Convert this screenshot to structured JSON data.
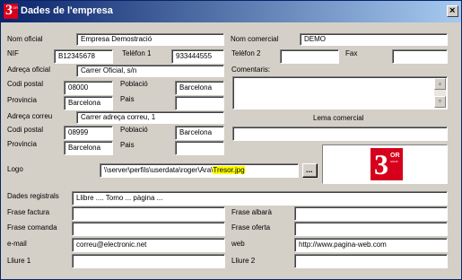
{
  "window": {
    "title": "Dades de l'empresa",
    "app_icon_text": "3",
    "app_icon_sup": "OR"
  },
  "labels": {
    "nom_oficial": "Nom oficial",
    "nif": "NIF",
    "telefon1": "Telèfon 1",
    "nom_comercial": "Nom comercial",
    "telefon2": "Telèfon 2",
    "fax": "Fax",
    "adreca_oficial": "Adreça oficial",
    "comentaris": "Comentaris:",
    "codi_postal": "Codi postal",
    "poblacio": "Població",
    "provincia": "Provincia",
    "pais": "Pais",
    "adreca_correu": "Adreça correu",
    "lema_comercial": "Lema comercial",
    "codi_postal2": "Codi postal",
    "poblacio2": "Població",
    "provincia2": "Provincia",
    "pais2": "Pais",
    "logo": "Logo",
    "dades_registrals": "Dades registrals",
    "frase_factura": "Frase factura",
    "frase_albara": "Frase albarà",
    "frase_comanda": "Frase comanda",
    "frase_oferta": "Frase oferta",
    "email": "e-mail",
    "web": "web",
    "lliure1": "Lliure 1",
    "lliure2": "Lliure 2"
  },
  "values": {
    "nom_oficial": "Empresa Demostració",
    "nif": "B12345678",
    "telefon1": "933444555",
    "nom_comercial": "DEMO",
    "telefon2": "",
    "fax": "",
    "adreca_oficial": "Carrer Oficial, s/n",
    "codi_postal": "08000",
    "poblacio": "Barcelona",
    "provincia": "Barcelona",
    "pais": "",
    "adreca_correu": "Carrer adreça correu, 1",
    "codi_postal2": "08999",
    "poblacio2": "Barcelona",
    "provincia2": "Barcelona",
    "pais2": "",
    "comentaris": "",
    "lema_comercial": "",
    "logo_path_prefix": "\\\\server\\perfils\\userdata\\roger\\Ara\\",
    "logo_path_file": "Tresor.jpg",
    "dades_registrals": "Llibre .... Tomo ... pàgina ...",
    "frase_factura": "",
    "frase_albara": "",
    "frase_comanda": "",
    "frase_oferta": "",
    "email": "correu@electronic.net",
    "web": "http://www.pagina-web.com",
    "lliure1": "",
    "lliure2": ""
  },
  "logo_preview": {
    "main": "3",
    "sup": "OR",
    "sub": "GRUP"
  },
  "buttons": {
    "browse": "...",
    "close": "×"
  },
  "icons": {
    "scroll_up": "▲",
    "scroll_down": "▼"
  },
  "colors": {
    "title_start": "#0a246a",
    "title_end": "#a6caf0",
    "logo_red": "#d6001c",
    "highlight": "#ffff00"
  }
}
